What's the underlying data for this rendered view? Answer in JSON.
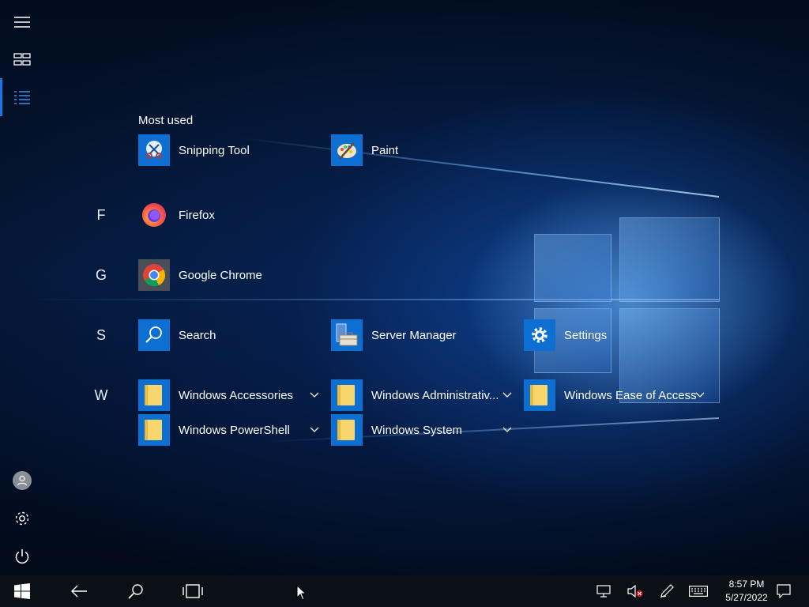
{
  "start_menu": {
    "most_used_title": "Most used",
    "most_used": [
      {
        "name": "Snipping Tool",
        "icon": "snipping-tool-icon"
      },
      {
        "name": "Paint",
        "icon": "paint-icon"
      }
    ],
    "groups": [
      {
        "letter": "F",
        "apps": [
          {
            "name": "Firefox",
            "icon": "firefox-icon"
          }
        ]
      },
      {
        "letter": "G",
        "apps": [
          {
            "name": "Google Chrome",
            "icon": "chrome-icon"
          }
        ]
      },
      {
        "letter": "S",
        "apps": [
          {
            "name": "Search",
            "icon": "search-icon"
          },
          {
            "name": "Server Manager",
            "icon": "server-manager-icon"
          },
          {
            "name": "Settings",
            "icon": "gear-icon"
          }
        ]
      },
      {
        "letter": "W",
        "apps": [
          {
            "name": "Windows Accessories",
            "icon": "folder-icon"
          },
          {
            "name": "Windows Administrativ...",
            "icon": "folder-icon"
          },
          {
            "name": "Windows Ease of Access",
            "icon": "folder-icon"
          },
          {
            "name": "Windows PowerShell",
            "icon": "folder-icon"
          },
          {
            "name": "Windows System",
            "icon": "folder-icon"
          }
        ]
      }
    ]
  },
  "left_rail": {
    "icons": [
      "hamburger-menu-icon",
      "tiles-view-icon",
      "all-apps-list-icon",
      "user-avatar-icon",
      "settings-gear-icon",
      "power-icon"
    ]
  },
  "taskbar": {
    "icons": [
      "windows-start-icon",
      "back-arrow-icon",
      "search-icon",
      "task-view-icon",
      "network-icon",
      "volume-muted-icon",
      "pen-icon",
      "touch-keyboard-icon",
      "action-center-icon"
    ],
    "clock_time": "8:57 PM",
    "clock_date": "5/27/2022"
  },
  "colors": {
    "accent": "#0c6fd1",
    "taskbar": "#0b0f16",
    "folder": "#f6d66d"
  }
}
